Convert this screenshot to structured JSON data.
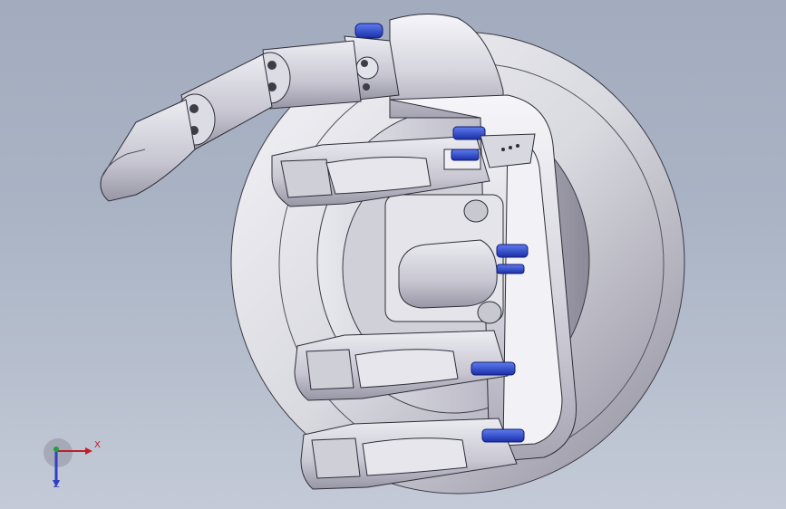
{
  "viewport": {
    "background_top": "#a2acbe",
    "background_bottom": "#c4cad7"
  },
  "model": {
    "part_color": "#d8d8de",
    "shadow_color": "#9a98a6",
    "fastener_color": "#1f3fd0"
  },
  "triad": {
    "x_label": "X",
    "z_label": "Z",
    "x_color": "#c0202a",
    "y_color": "#20a040",
    "z_color": "#3040c0"
  }
}
